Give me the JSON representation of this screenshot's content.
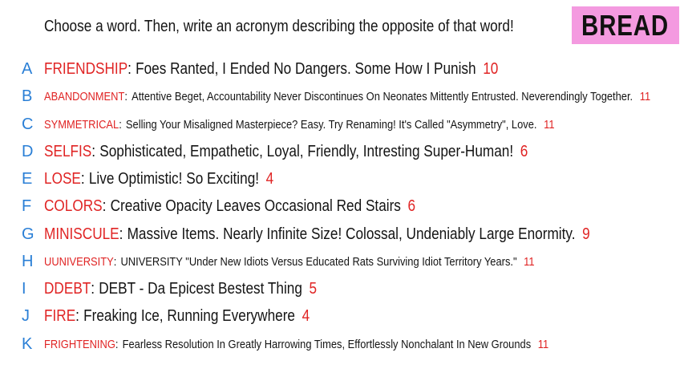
{
  "prompt": "Choose a word. Then, write an acronym describing the opposite of that word!",
  "logo": "BREAD",
  "colors": {
    "letter": "#2a7fd6",
    "word": "#e02424",
    "text": "#141414",
    "logo_bg": "#f49ae0"
  },
  "entries": [
    {
      "letter": "A",
      "word": "FRIENDSHIP",
      "definition": "Foes Ranted, I Ended No Dangers. Some How I Punish",
      "count": "10"
    },
    {
      "letter": "B",
      "word": "ABANDONMENT",
      "definition": "Attentive Beget, Accountability Never Discontinues On Neonates Mittently Entrusted. Neverendingly Together.",
      "count": "11"
    },
    {
      "letter": "C",
      "word": "SYMMETRICAL",
      "definition": "Selling Your Misaligned Masterpiece? Easy. Try Renaming! It's Called \"Asymmetry\", Love.",
      "count": "11"
    },
    {
      "letter": "D",
      "word": "SELFIS",
      "definition": "Sophisticated, Empathetic, Loyal, Friendly, Intresting Super-Human!",
      "count": "6"
    },
    {
      "letter": "E",
      "word": "LOSE",
      "definition": "Live Optimistic! So Exciting!",
      "count": "4"
    },
    {
      "letter": "F",
      "word": "COLORS",
      "definition": "Creative Opacity Leaves Occasional Red Stairs",
      "count": "6"
    },
    {
      "letter": "G",
      "word": "MINISCULE",
      "definition": "Massive Items. Nearly Infinite Size! Colossal, Undeniably Large Enormity.",
      "count": "9"
    },
    {
      "letter": "H",
      "word": "UUNIVERSITY",
      "definition": "UNIVERSITY \"Under New Idiots Versus Educated Rats Surviving Idiot Territory Years.\"",
      "count": "11"
    },
    {
      "letter": "I",
      "word": "DDEBT",
      "definition": "DEBT - Da Epicest Bestest Thing",
      "count": "5"
    },
    {
      "letter": "J",
      "word": "FIRE",
      "definition": "Freaking Ice, Running Everywhere",
      "count": "4"
    },
    {
      "letter": "K",
      "word": "FRIGHTENING",
      "definition": "Fearless Resolution In Greatly Harrowing Times, Effortlessly Nonchalant In New Grounds",
      "count": "11"
    }
  ]
}
